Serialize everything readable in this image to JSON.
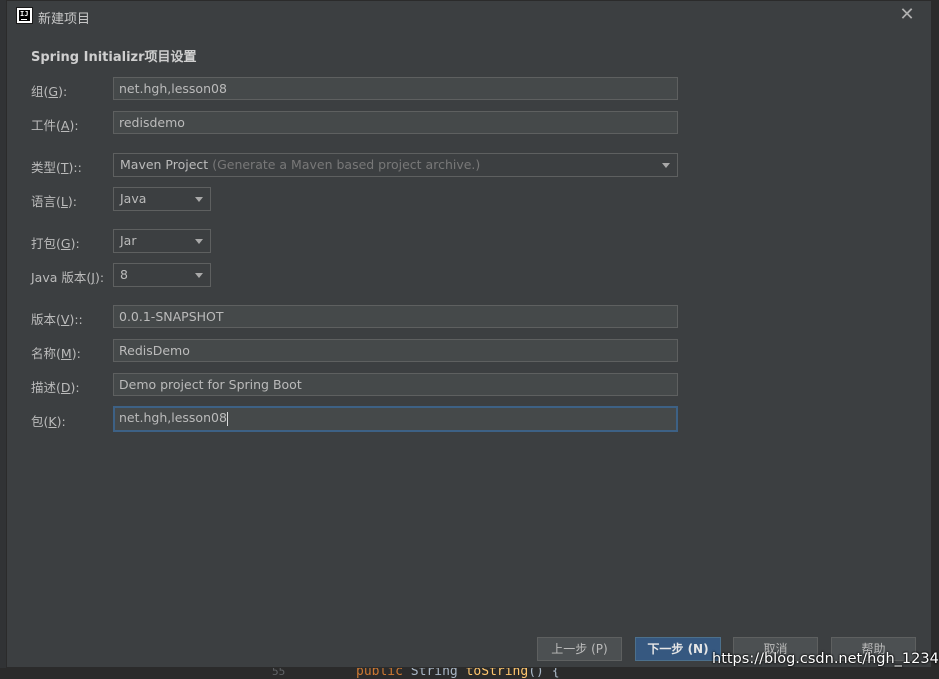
{
  "window": {
    "title": "新建项目",
    "app_icon_text": "IJ"
  },
  "section_title": "Spring Initializr项目设置",
  "form": {
    "group": {
      "label_pre": "组(",
      "mnemonic": "G",
      "label_post": "):",
      "value": "net.hgh,lesson08"
    },
    "artifact": {
      "label_pre": "工件(",
      "mnemonic": "A",
      "label_post": "):",
      "value": "redisdemo"
    },
    "type": {
      "label_pre": "类型(",
      "mnemonic": "T",
      "label_post": ")::",
      "value": "Maven Project",
      "hint": "(Generate a Maven based project archive.)"
    },
    "language": {
      "label_pre": "语言(",
      "mnemonic": "L",
      "label_post": "):",
      "value": "Java"
    },
    "packaging": {
      "label_pre": "打包(",
      "mnemonic": "G",
      "label_post": "):",
      "value": "Jar"
    },
    "java_version": {
      "label_pre": "Java 版本(",
      "mnemonic": "J",
      "label_post": "):",
      "value": "8"
    },
    "version": {
      "label_pre": "版本(",
      "mnemonic": "V",
      "label_post": ")::",
      "value": "0.0.1-SNAPSHOT"
    },
    "name": {
      "label_pre": "名称(",
      "mnemonic": "M",
      "label_post": "):",
      "value": "RedisDemo"
    },
    "description": {
      "label_pre": "描述(",
      "mnemonic": "D",
      "label_post": "):",
      "value": "Demo project for Spring Boot"
    },
    "package": {
      "label_pre": "包(",
      "mnemonic": "K",
      "label_post": "):",
      "value": "net.hgh,lesson08"
    }
  },
  "buttons": {
    "previous": "上一步 (P)",
    "next": "下一步 (N)",
    "cancel": "取消",
    "help": "帮助"
  },
  "background_editor": {
    "line_number": "55",
    "code_keyword": "public",
    "code_type": "String",
    "code_method": "toString",
    "code_tail": "() {"
  },
  "watermark": "https://blog.csdn.net/hgh_1234",
  "colors": {
    "dialog_bg": "#3c3f41",
    "field_bg": "#45494a",
    "focus_border": "#3d6185",
    "primary_button": "#365880"
  }
}
